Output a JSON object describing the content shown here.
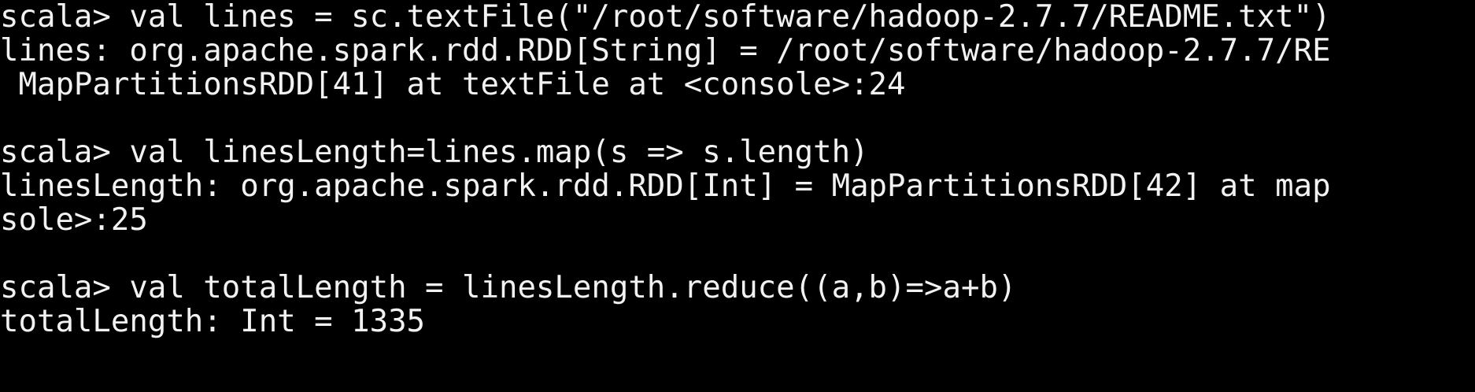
{
  "terminal": {
    "lines": [
      "scala> val lines = sc.textFile(\"/root/software/hadoop-2.7.7/README.txt\")",
      "lines: org.apache.spark.rdd.RDD[String] = /root/software/hadoop-2.7.7/RE",
      " MapPartitionsRDD[41] at textFile at <console>:24",
      "",
      "scala> val linesLength=lines.map(s => s.length)",
      "linesLength: org.apache.spark.rdd.RDD[Int] = MapPartitionsRDD[42] at map",
      "sole>:25",
      "",
      "scala> val totalLength = linesLength.reduce((a,b)=>a+b)",
      "totalLength: Int = 1335"
    ],
    "colors": {
      "background": "#000000",
      "foreground": "#f2f2f2"
    }
  }
}
